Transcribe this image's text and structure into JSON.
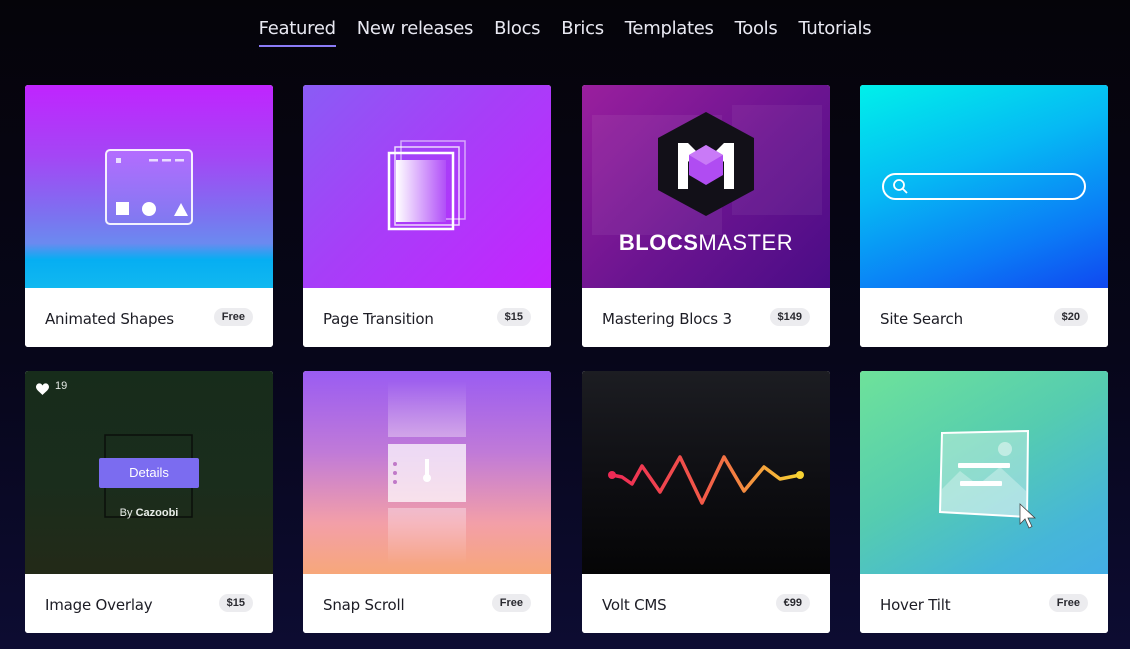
{
  "nav": {
    "tabs": [
      "Featured",
      "New releases",
      "Blocs",
      "Brics",
      "Templates",
      "Tools",
      "Tutorials"
    ],
    "active": "Featured"
  },
  "colors": {
    "accent": "#8b7bf6",
    "background": "#07061a",
    "card": "#ffffff",
    "price_badge": "#ececef"
  },
  "cards": [
    {
      "title": "Animated Shapes",
      "price": "Free"
    },
    {
      "title": "Page Transition",
      "price": "$15"
    },
    {
      "title": "Mastering Blocs 3",
      "price": "$149",
      "brand": "BLOCSMASTER"
    },
    {
      "title": "Site Search",
      "price": "$20"
    },
    {
      "title": "Image Overlay",
      "price": "$15",
      "likes": "19",
      "overlay_button": "Details",
      "by_text": "By",
      "author": "Cazoobi"
    },
    {
      "title": "Snap Scroll",
      "price": "Free"
    },
    {
      "title": "Volt CMS",
      "price": "€99"
    },
    {
      "title": "Hover Tilt",
      "price": "Free"
    }
  ]
}
